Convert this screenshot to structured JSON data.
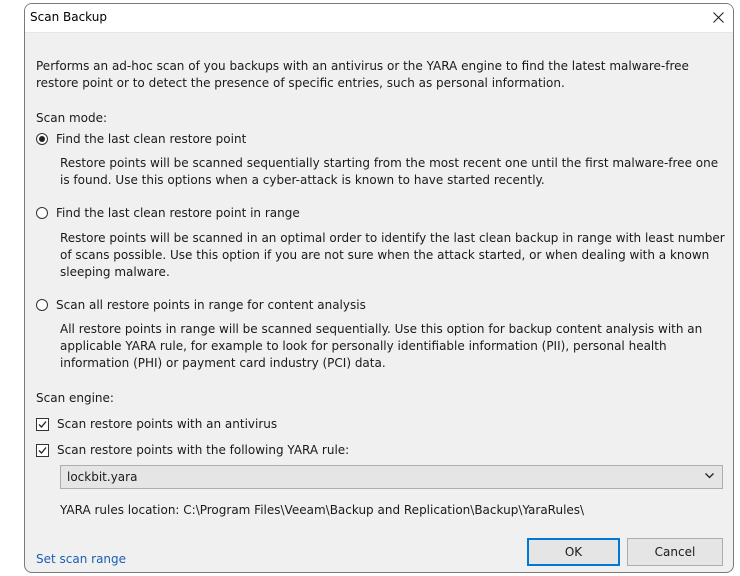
{
  "dialog": {
    "title": "Scan Backup",
    "description": "Performs an ad-hoc scan of you backups with an antivirus or the YARA engine to find the latest malware-free restore point or to detect the presence of specific entries, such as personal information."
  },
  "scan_mode": {
    "label": "Scan mode:",
    "options": [
      {
        "label": "Find the last clean restore point",
        "selected": true,
        "description": "Restore points will be scanned sequentially starting from the most recent one until the first malware-free one is found. Use this options when a cyber-attack is known to have started recently."
      },
      {
        "label": "Find the last clean restore point in range",
        "selected": false,
        "description": "Restore points will be scanned in an optimal order to identify the last clean backup in range with least number of scans possible. Use this option if you are not sure when the attack started, or when dealing with a known sleeping malware."
      },
      {
        "label": "Scan all restore points in range for content analysis",
        "selected": false,
        "description": "All restore points in range will be scanned sequentially. Use this option for backup content analysis with an applicable YARA rule, for example to look for personally identifiable information (PII), personal health information (PHI) or payment card industry (PCI) data."
      }
    ]
  },
  "scan_engine": {
    "label": "Scan engine:",
    "antivirus_label": "Scan restore points with an antivirus",
    "antivirus_checked": true,
    "yara_label": "Scan restore points with the following YARA rule:",
    "yara_checked": true,
    "yara_rule": "lockbit.yara",
    "yara_location": "YARA rules location: C:\\Program Files\\Veeam\\Backup and Replication\\Backup\\YaraRules\\"
  },
  "footer": {
    "link_label": "Set scan range",
    "ok_label": "OK",
    "cancel_label": "Cancel"
  },
  "icons": {
    "close": "close-icon",
    "check": "checkmark-icon",
    "chevron": "chevron-down-icon"
  }
}
